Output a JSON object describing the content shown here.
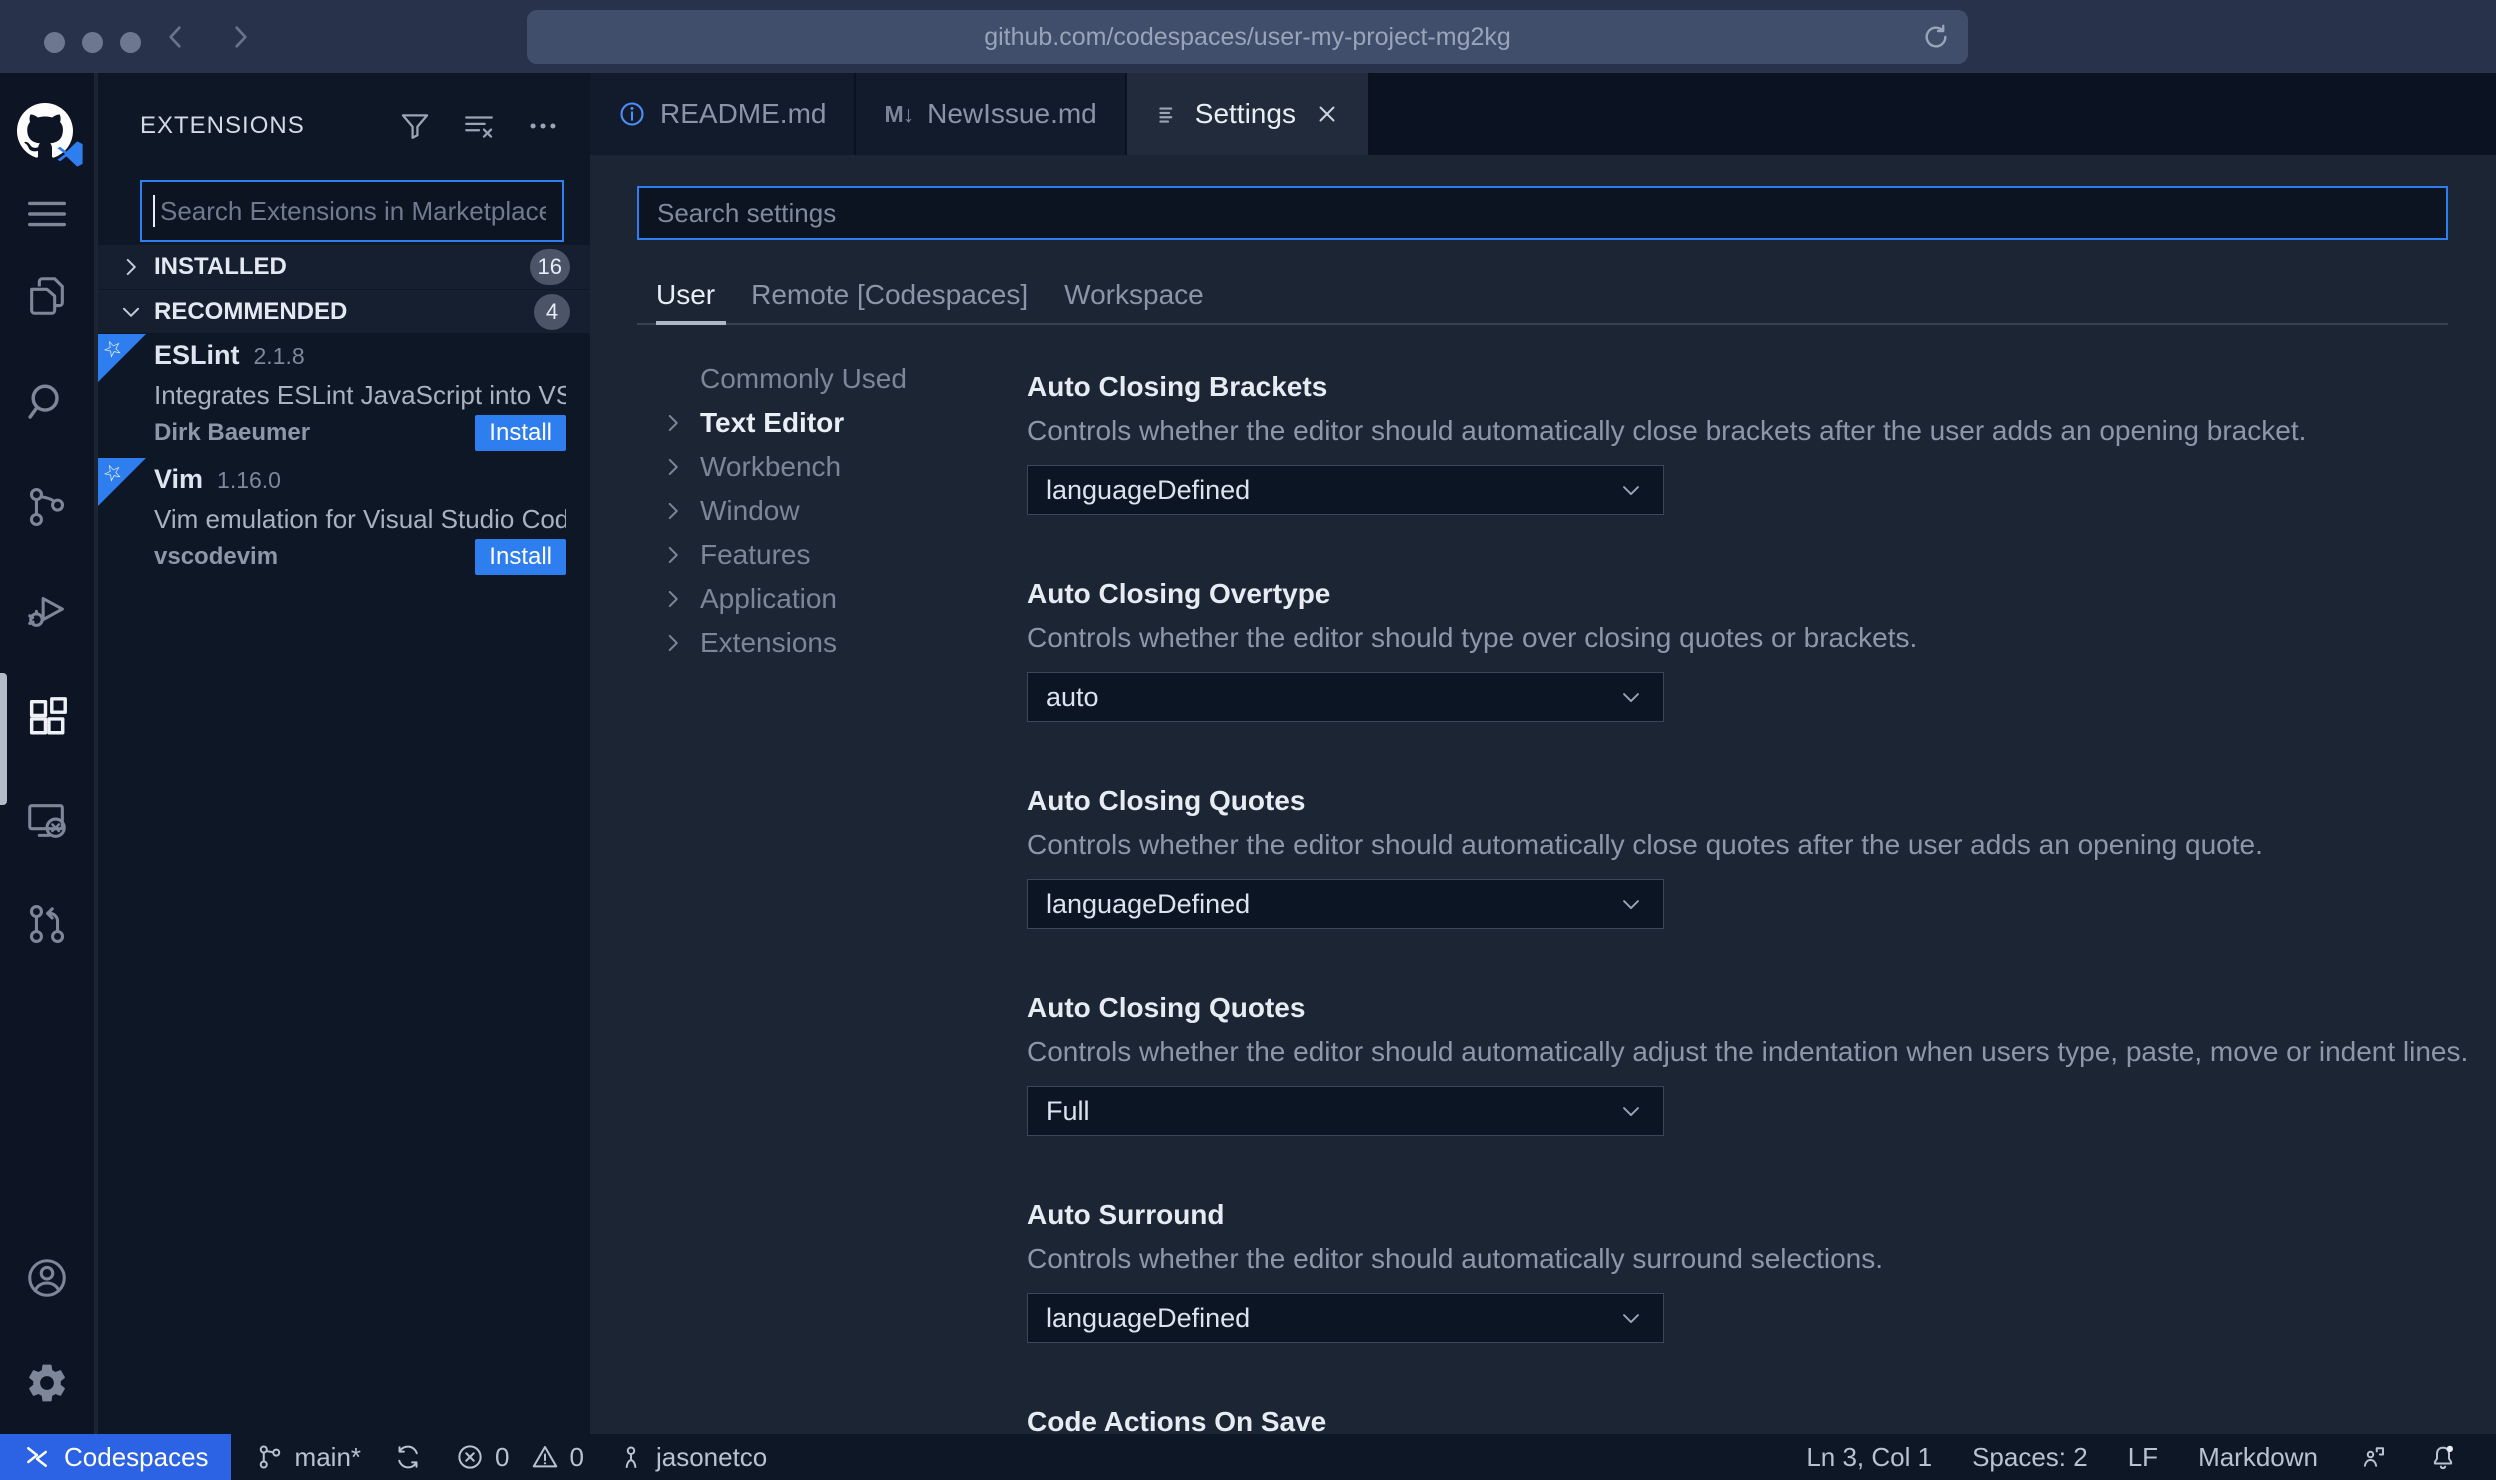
{
  "browser": {
    "url": "github.com/codespaces/user-my-project-mg2kg",
    "traffic_lights": [
      "close",
      "minimize",
      "zoom"
    ]
  },
  "activity_bar": {
    "icons": [
      "github-codespaces-logo",
      "menu",
      "files-explorer",
      "search",
      "source-control",
      "run-debug",
      "extensions",
      "remote-explorer",
      "github-pull-request",
      "account",
      "settings-gear"
    ],
    "active": "extensions"
  },
  "sidebar": {
    "title": "EXTENSIONS",
    "toolbar_icons": [
      "filter",
      "clear-search-results",
      "more-actions"
    ],
    "search": {
      "value": "",
      "placeholder": "Search Extensions in Marketplace"
    },
    "sections": [
      {
        "label": "INSTALLED",
        "count": "16",
        "collapsed": true
      },
      {
        "label": "RECOMMENDED",
        "count": "4",
        "collapsed": false
      }
    ],
    "extensions": [
      {
        "name": "ESLint",
        "version": "2.1.8",
        "description": "Integrates ESLint JavaScript into VS C...",
        "publisher": "Dirk Baeumer",
        "action": "Install"
      },
      {
        "name": "Vim",
        "version": "1.16.0",
        "description": "Vim emulation for Visual Studio Code...",
        "publisher": "vscodevim",
        "action": "Install"
      }
    ]
  },
  "editor": {
    "tabs": [
      {
        "label": "README.md",
        "icon": "info-icon",
        "active": false
      },
      {
        "label": "NewIssue.md",
        "icon": "markdown-icon",
        "active": false
      },
      {
        "label": "Settings",
        "icon": "settings-list-icon",
        "active": true,
        "closable": true
      }
    ]
  },
  "settings": {
    "search": {
      "value": "",
      "placeholder": "Search settings"
    },
    "scopes": [
      "User",
      "Remote [Codespaces]",
      "Workspace"
    ],
    "active_scope": "User",
    "toc": [
      "Commonly Used",
      "Text Editor",
      "Workbench",
      "Window",
      "Features",
      "Application",
      "Extensions"
    ],
    "active_toc": "Text Editor",
    "items": [
      {
        "title": "Auto Closing Brackets",
        "description": "Controls whether the editor should automatically close brackets after the user adds an opening bracket.",
        "value": "languageDefined"
      },
      {
        "title": "Auto Closing Overtype",
        "description": "Controls whether the editor should type over closing quotes or brackets.",
        "value": "auto"
      },
      {
        "title": "Auto Closing Quotes",
        "description": "Controls whether the editor should automatically close quotes after the user adds an opening quote.",
        "value": "languageDefined"
      },
      {
        "title": "Auto Closing Quotes",
        "description": "Controls whether the editor should automatically adjust the indentation when users type, paste, move or indent lines.",
        "value": "Full"
      },
      {
        "title": "Auto Surround",
        "description": "Controls whether the editor should automatically surround selections.",
        "value": "languageDefined"
      },
      {
        "title": "Code Actions On Save",
        "description": "",
        "value": ""
      }
    ]
  },
  "status_bar": {
    "remote_label": "Codespaces",
    "branch": "main*",
    "errors": "0",
    "warnings": "0",
    "user": "jasonetco",
    "cursor": "Ln 3, Col 1",
    "indent": "Spaces: 2",
    "eol": "LF",
    "language": "Markdown"
  },
  "colors": {
    "accent_blue": "#2e7ef0",
    "focus_border": "#2d7ff0",
    "remote_badge_bg": "#2c63e4",
    "editor_bg": "#1b2534",
    "sidebar_bg": "#0e1726",
    "chrome_bg": "#28324b"
  }
}
